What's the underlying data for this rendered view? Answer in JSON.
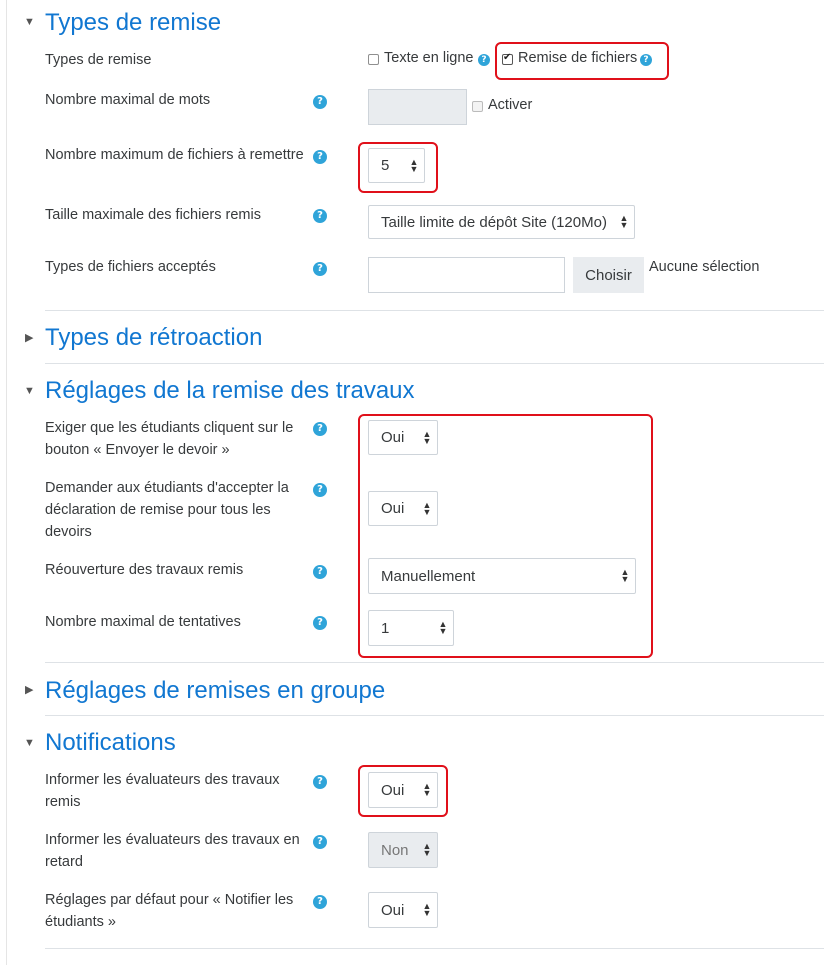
{
  "sections": {
    "submission_types": {
      "title": "Types de remise"
    },
    "feedback_types": {
      "title": "Types de rétroaction"
    },
    "submission_settings": {
      "title": "Réglages de la remise des travaux"
    },
    "group_submission": {
      "title": "Réglages de remises en groupe"
    },
    "notifications": {
      "title": "Notifications"
    }
  },
  "submission_types": {
    "label": "Types de remise",
    "online_text": {
      "label": "Texte en ligne",
      "checked": false
    },
    "file_submissions": {
      "label": "Remise de fichiers",
      "checked": true
    },
    "word_limit": {
      "label": "Nombre maximal de mots",
      "value": "",
      "enable_label": "Activer",
      "enabled": false
    },
    "max_files": {
      "label": "Nombre maximum de fichiers à remettre",
      "value": "5"
    },
    "max_size": {
      "label": "Taille maximale des fichiers remis",
      "value": "Taille limite de dépôt Site (120Mo)"
    },
    "accepted_types": {
      "label": "Types de fichiers acceptés",
      "value": "",
      "button_label": "Choisir",
      "selection_text": "Aucune sélection"
    }
  },
  "submission_settings": {
    "require_submit": {
      "label": "Exiger que les étudiants cliquent sur le bouton « Envoyer le devoir »",
      "value": "Oui"
    },
    "require_statement": {
      "label": "Demander aux étudiants d'accepter la déclaration de remise pour tous les devoirs",
      "value": "Oui"
    },
    "reopen": {
      "label": "Réouverture des travaux remis",
      "value": "Manuellement"
    },
    "max_attempts": {
      "label": "Nombre maximal de tentatives",
      "value": "1"
    }
  },
  "notifications": {
    "notify_graders": {
      "label": "Informer les évaluateurs des travaux remis",
      "value": "Oui"
    },
    "notify_late": {
      "label": "Informer les évaluateurs des travaux en retard",
      "value": "Non"
    },
    "notify_students_default": {
      "label": "Réglages par défaut pour « Notifier les étudiants »",
      "value": "Oui"
    }
  },
  "icons": {
    "help": "?",
    "caret_open": "▼",
    "caret_closed": "▶"
  },
  "colors": {
    "accent": "#1177d1",
    "help": "#2fa4d9",
    "highlight": "#e0101a"
  }
}
